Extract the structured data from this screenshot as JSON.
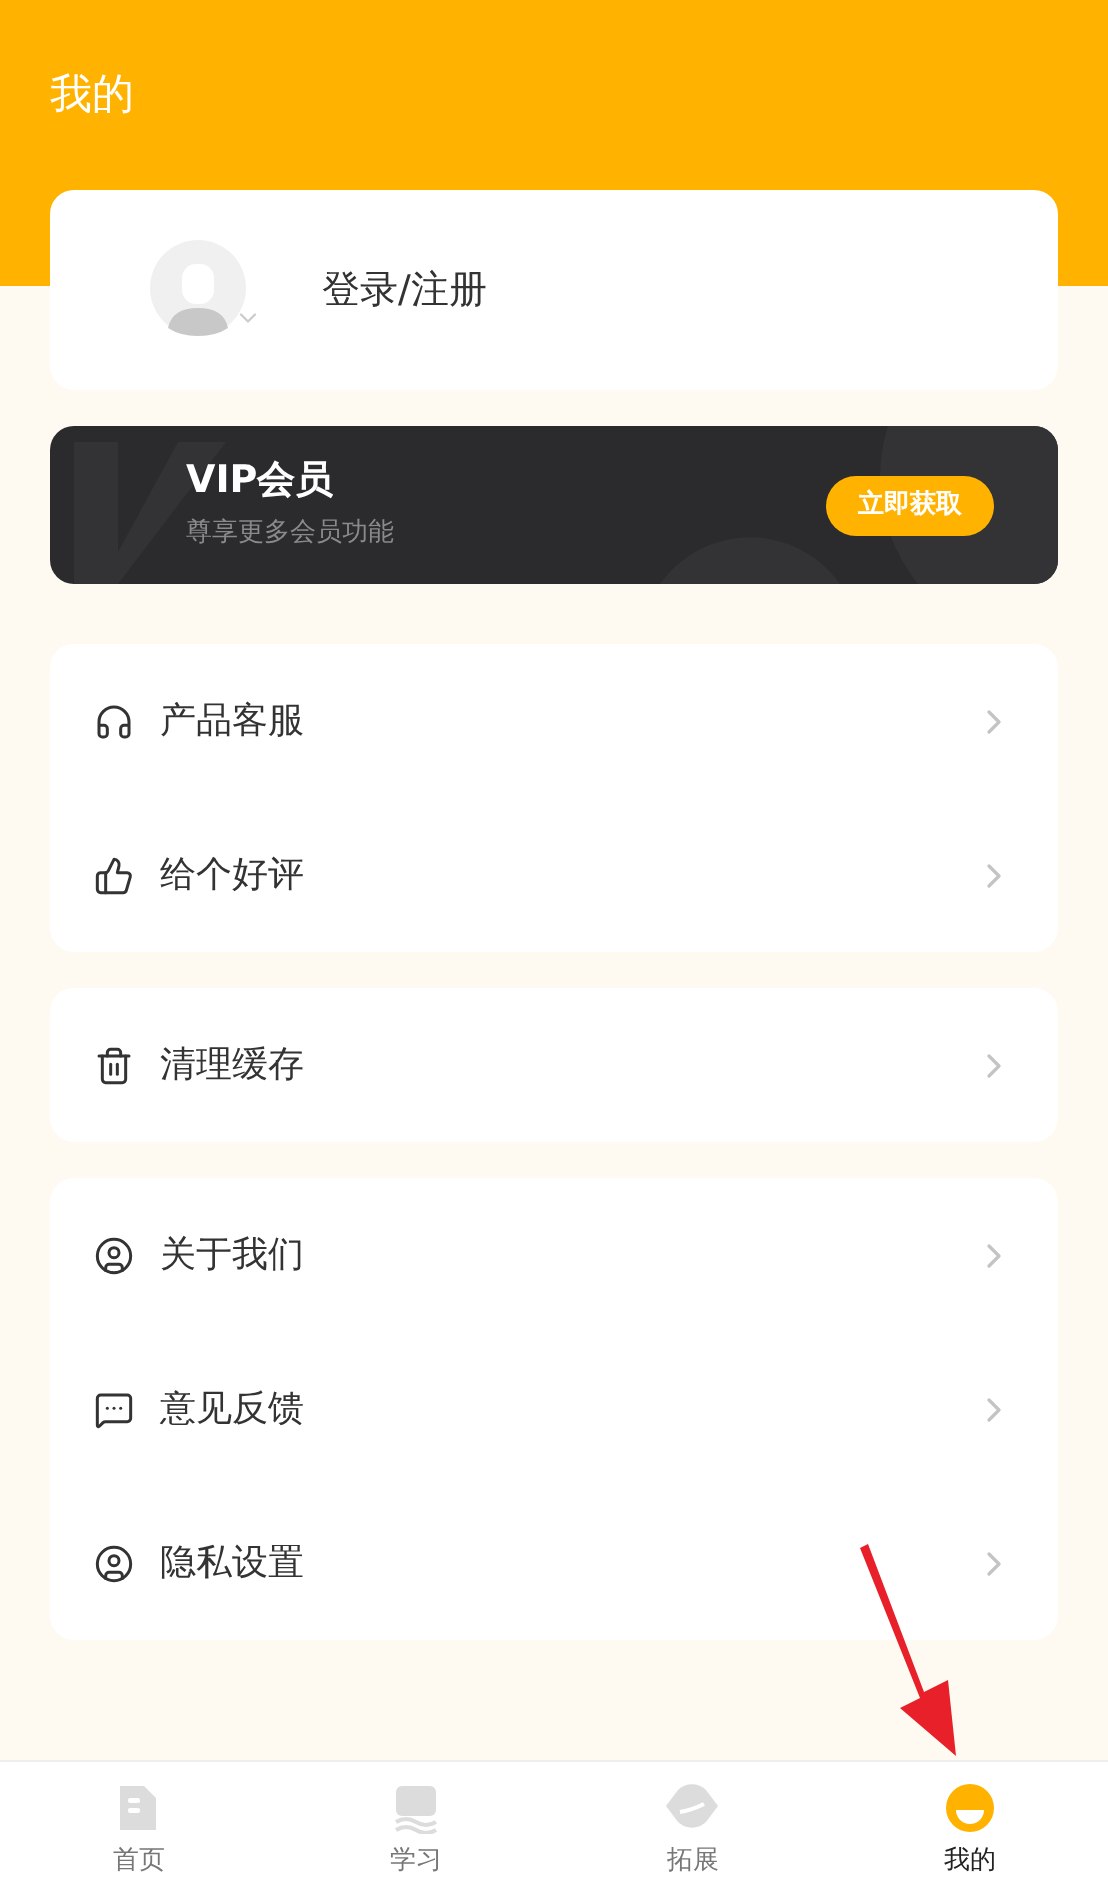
{
  "header": {
    "title": "我的"
  },
  "profile": {
    "login_label": "登录/注册"
  },
  "vip": {
    "title": "VIP会员",
    "subtitle": "尊享更多会员功能",
    "button": "立即获取"
  },
  "menu_groups": [
    {
      "items": [
        {
          "kind": "headset",
          "label": "产品客服"
        },
        {
          "kind": "thumbs-up",
          "label": "给个好评"
        }
      ]
    },
    {
      "items": [
        {
          "kind": "trash",
          "label": "清理缓存"
        }
      ]
    },
    {
      "items": [
        {
          "kind": "user-circle",
          "label": "关于我们"
        },
        {
          "kind": "message",
          "label": "意见反馈"
        },
        {
          "kind": "user-circle",
          "label": "隐私设置"
        }
      ]
    }
  ],
  "tab_bar": [
    {
      "kind": "home",
      "label": "首页",
      "selected": false
    },
    {
      "kind": "book",
      "label": "学习",
      "selected": false
    },
    {
      "kind": "planet",
      "label": "拓展",
      "selected": false
    },
    {
      "kind": "face",
      "label": "我的",
      "selected": true
    }
  ]
}
